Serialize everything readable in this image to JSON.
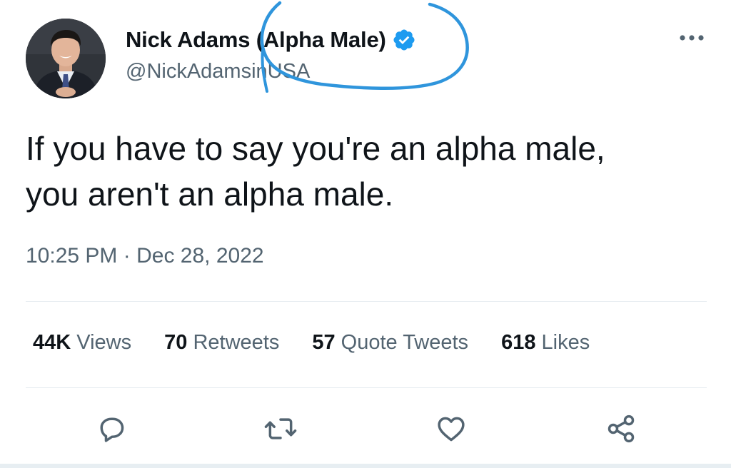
{
  "author": {
    "display_name": "Nick Adams (Alpha Male)",
    "handle": "@NickAdamsinUSA",
    "avatar_icon": "avatar-photo",
    "verified_icon": "verified-badge-icon",
    "verified_color": "#1d9bf0"
  },
  "tweet": {
    "text": "If you have to say you're an alpha male,\nyou aren't an alpha male.",
    "time": "10:25 PM",
    "separator": "·",
    "date": "Dec 28, 2022"
  },
  "stats": [
    {
      "value": "44K",
      "label": "Views"
    },
    {
      "value": "70",
      "label": "Retweets"
    },
    {
      "value": "57",
      "label": "Quote Tweets"
    },
    {
      "value": "618",
      "label": "Likes"
    }
  ],
  "actions": [
    "reply-icon",
    "retweet-icon",
    "like-icon",
    "share-icon"
  ],
  "more_icon": "more-icon",
  "colors": {
    "text_primary": "#0f1419",
    "text_secondary": "#536471",
    "annotation_blue": "#2f95dc",
    "divider": "#e6ecf0"
  }
}
